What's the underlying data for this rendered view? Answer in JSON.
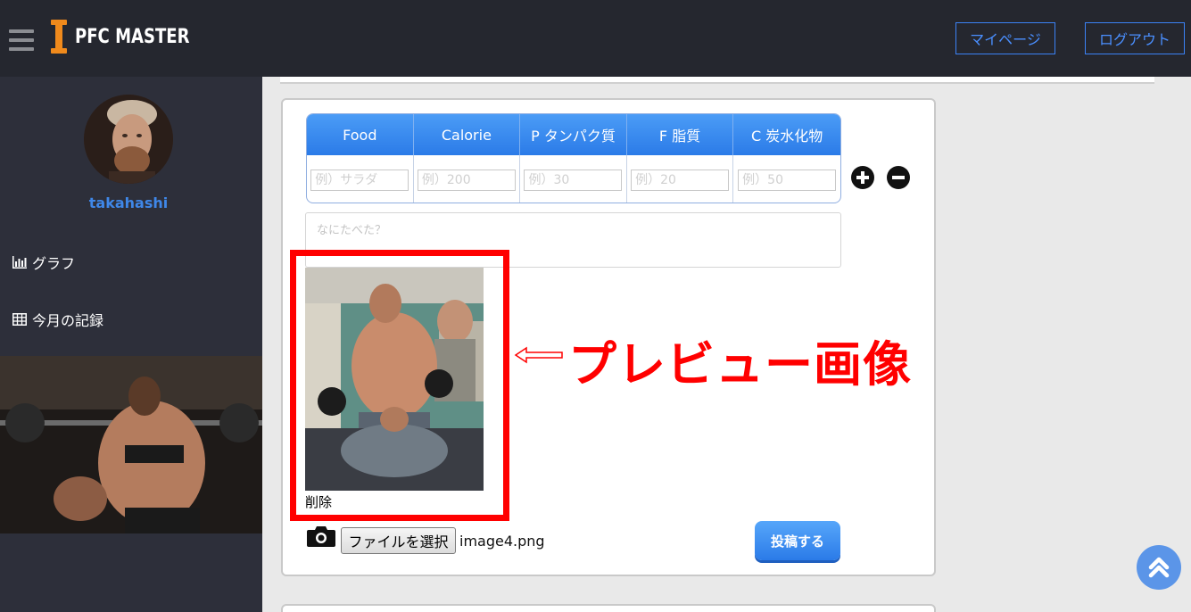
{
  "header": {
    "logo_text": "PFC MASTER",
    "mypage_label": "マイページ",
    "logout_label": "ログアウト"
  },
  "sidebar": {
    "username": "takahashi",
    "items": [
      {
        "label": "グラフ",
        "icon": "bar-chart-icon"
      },
      {
        "label": "今月の記録",
        "icon": "table-icon"
      }
    ]
  },
  "form": {
    "columns": [
      "Food",
      "Calorie",
      "P タンパク質",
      "F 脂質",
      "C 炭水化物"
    ],
    "placeholders": [
      "例）サラダ",
      "例）200",
      "例）30",
      "例）20",
      "例）50"
    ],
    "textarea_placeholder": "なにたべた？",
    "delete_label": "削除",
    "file_button_label": "ファイルを選択",
    "file_name": "image4.png",
    "submit_label": "投稿する"
  },
  "annotation": {
    "label": "プレビュー画像",
    "color": "#ff0000"
  },
  "colors": {
    "header_bg": "#25272f",
    "sidebar_bg": "#2d2f3a",
    "accent_blue": "#3b82f6",
    "logo_orange": "#f08a1c"
  }
}
